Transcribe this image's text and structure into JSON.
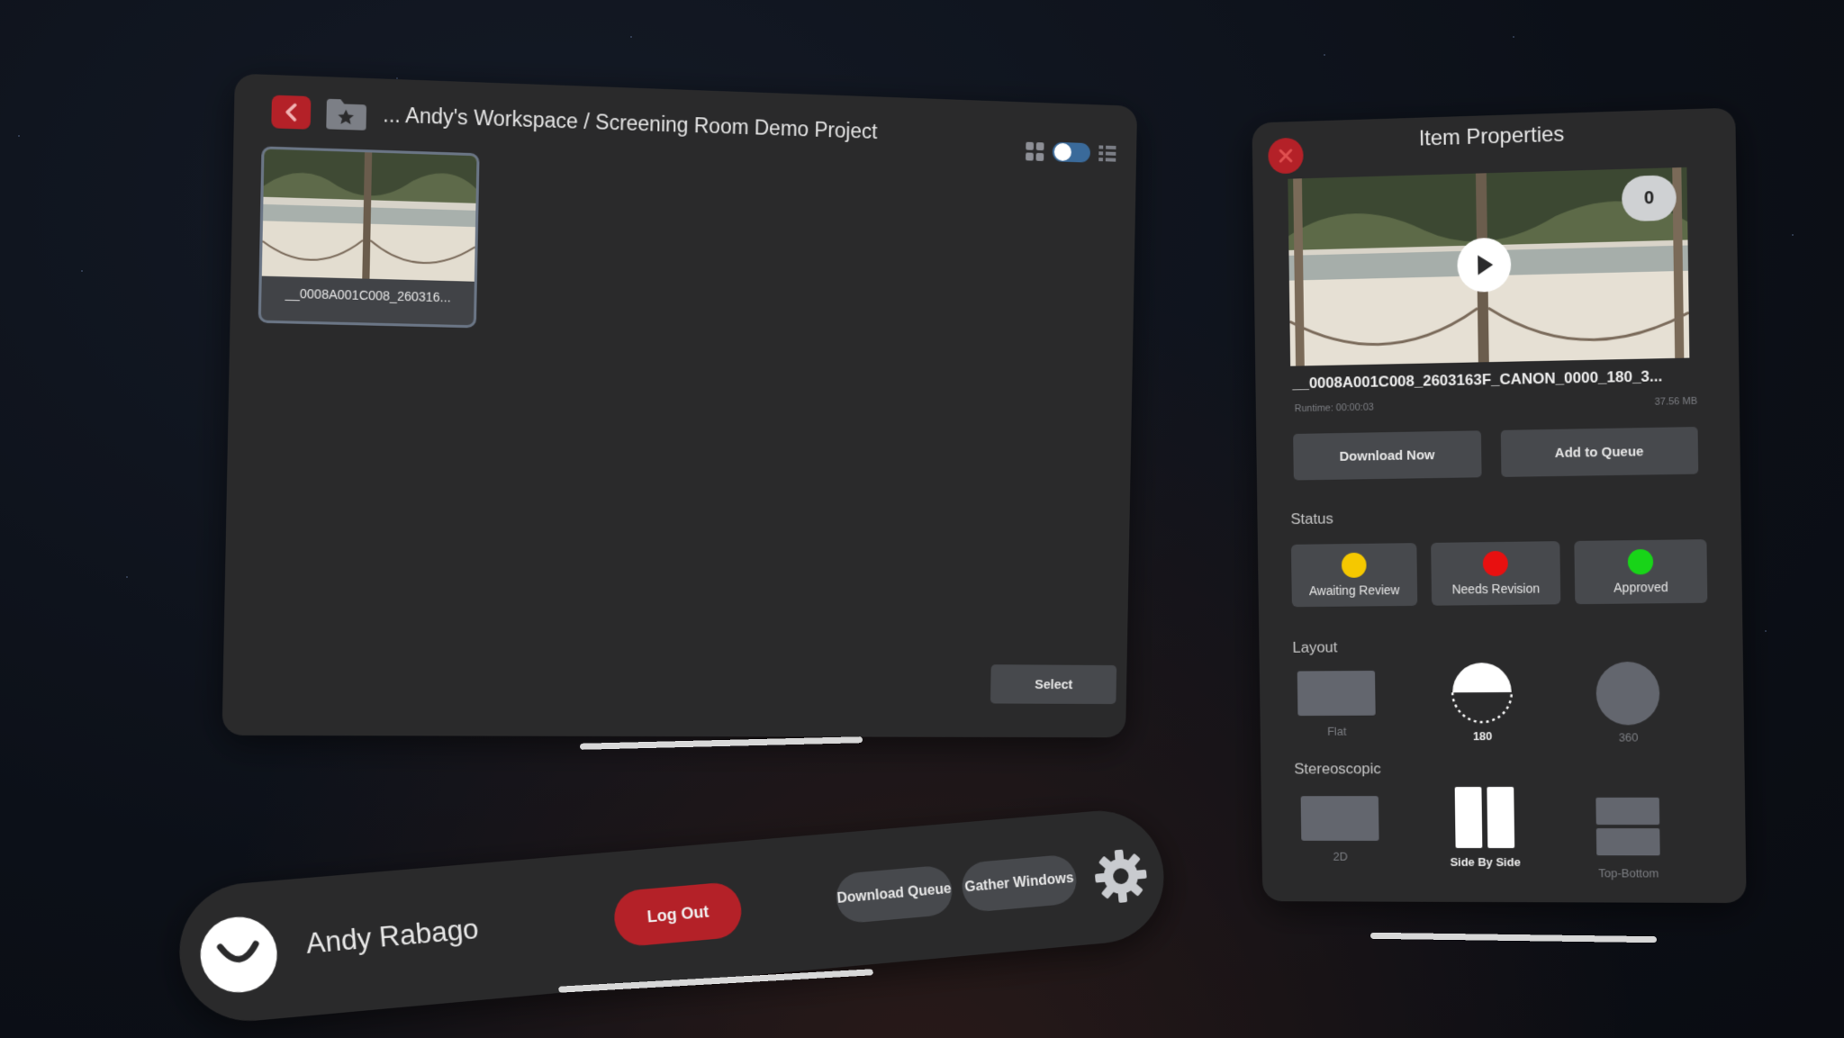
{
  "browser": {
    "breadcrumb": "... Andy's Workspace / Screening Room Demo Project",
    "files": [
      {
        "name": "__0008A001C008_260316..."
      }
    ],
    "select_label": "Select"
  },
  "properties": {
    "title": "Item Properties",
    "comment_count": "0",
    "item_name": "__0008A001C008_2603163F_CANON_0000_180_3...",
    "runtime": "Runtime: 00:00:03",
    "file_size": "37.56 MB",
    "download_now_label": "Download Now",
    "add_to_queue_label": "Add to Queue",
    "status_section": "Status",
    "statuses": [
      {
        "label": "Awaiting Review",
        "color": "#f5c800"
      },
      {
        "label": "Needs Revision",
        "color": "#e81010"
      },
      {
        "label": "Approved",
        "color": "#18d418"
      }
    ],
    "layout_section": "Layout",
    "layouts": [
      {
        "label": "Flat",
        "selected": false
      },
      {
        "label": "180",
        "selected": true
      },
      {
        "label": "360",
        "selected": false
      }
    ],
    "stereo_section": "Stereoscopic",
    "stereo_modes": [
      {
        "label": "2D",
        "selected": false
      },
      {
        "label": "Side By Side",
        "selected": true
      },
      {
        "label": "Top-Bottom",
        "selected": false
      }
    ]
  },
  "dock": {
    "user_name": "Andy Rabago",
    "logout_label": "Log Out",
    "download_queue_label": "Download Queue",
    "gather_windows_label": "Gather Windows"
  },
  "colors": {
    "accent_red": "#b42128",
    "panel_bg": "#2a2a2b",
    "button_bg": "#47494d"
  }
}
